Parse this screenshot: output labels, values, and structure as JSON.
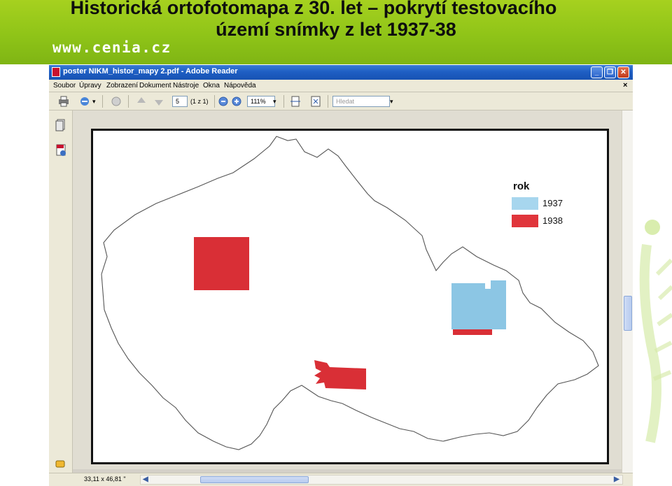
{
  "slide": {
    "title_line1": "Historická ortofotomapa z 30. let – pokrytí testovacího",
    "title_line2": "území snímky z let 1937-38",
    "website": "www.cenia.cz"
  },
  "window": {
    "title": "poster NIKM_histor_mapy 2.pdf - Adobe Reader"
  },
  "menu": [
    "Soubor",
    "Úpravy",
    "Zobrazení",
    "Dokument",
    "Nástroje",
    "Okna",
    "Nápověda"
  ],
  "toolbar": {
    "page_number": "5",
    "page_count": "(1 z 1)",
    "zoom": "111%",
    "search_placeholder": "Hledat"
  },
  "legend": {
    "title": "rok",
    "items": [
      {
        "label": "1937",
        "color": "#a7d6ee"
      },
      {
        "label": "1938",
        "color": "#e0353b"
      }
    ]
  },
  "status": {
    "coordinates": "33,11 x 46,81 \""
  },
  "colors": {
    "banner": "#8fc418",
    "titlebar": "#1f5fc4",
    "region_1937": "#8cc6e4",
    "region_1938": "#d92f36"
  }
}
